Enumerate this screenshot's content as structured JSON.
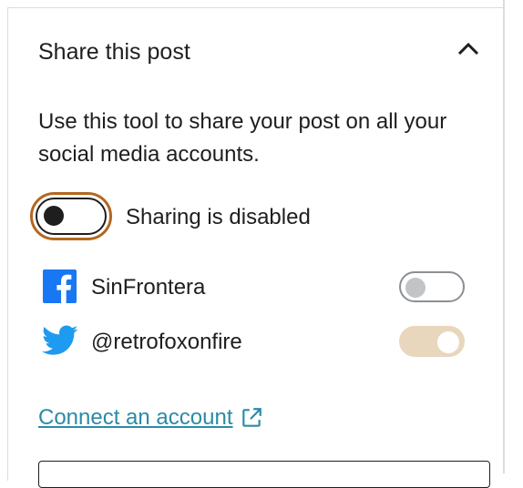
{
  "panel": {
    "title": "Share this post",
    "description": "Use this tool to share your post on all your social media accounts."
  },
  "sharing": {
    "label": "Sharing is disabled",
    "enabled": false
  },
  "accounts": [
    {
      "service": "facebook",
      "icon": "facebook-icon",
      "name": "SinFrontera",
      "enabled": false
    },
    {
      "service": "twitter",
      "icon": "twitter-icon",
      "name": "@retrofoxonfire",
      "enabled": true
    }
  ],
  "connect": {
    "label": "Connect an account",
    "icon": "external-link-icon"
  },
  "colors": {
    "accent_ring": "#b4671e",
    "link": "#2c8aa6",
    "toggle_on": "#e8d7bd",
    "facebook": "#1877f2",
    "twitter": "#1d9bf0"
  }
}
